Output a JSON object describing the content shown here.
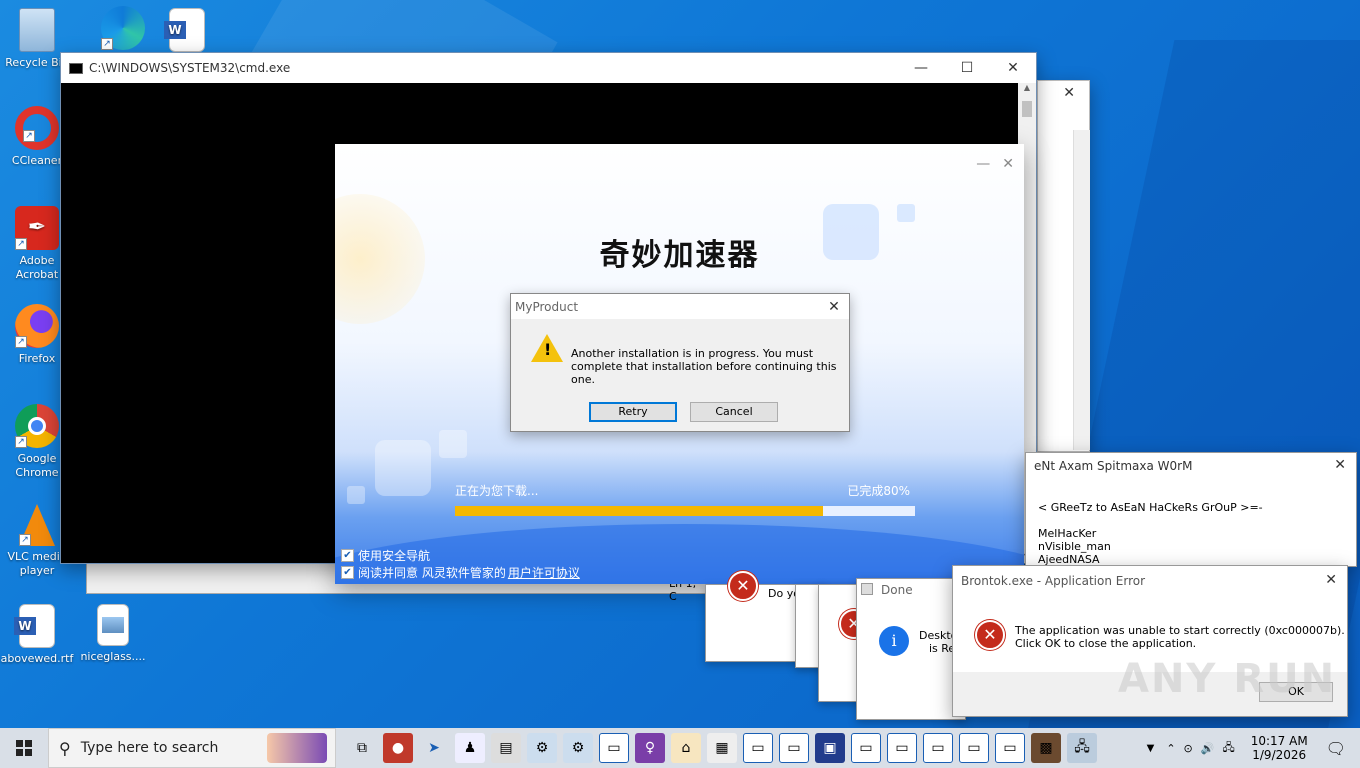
{
  "colors": {
    "accent": "#0078d7",
    "progress": "#f5b800",
    "error": "#c42b1c",
    "info": "#1a73e8"
  },
  "desktop": {
    "icons": [
      {
        "label": "Recycle Bin",
        "icon": "recycle-bin-icon"
      },
      {
        "label": "CCleaner",
        "icon": "ccleaner-icon"
      },
      {
        "label": "Adobe Acrobat",
        "icon": "adobe-acrobat-icon"
      },
      {
        "label": "Firefox",
        "icon": "firefox-icon"
      },
      {
        "label": "Google Chrome",
        "icon": "chrome-icon"
      },
      {
        "label": "VLC media player",
        "icon": "vlc-icon"
      },
      {
        "label": "abovewed.rtf",
        "icon": "word-doc-icon"
      },
      {
        "label": "niceglass....",
        "icon": "image-file-icon"
      }
    ]
  },
  "cmd": {
    "title": "C:\\WINDOWS\\SYSTEM32\\cmd.exe"
  },
  "installer": {
    "title": "奇妙加速器",
    "status": "正在为您下载...",
    "percent_label": "已完成80%",
    "progress": 0.8,
    "check1": "使用安全导航",
    "check2": "阅读并同意 风灵软件管家的",
    "license_link": "用户许可协议"
  },
  "myproduct": {
    "title": "MyProduct",
    "message": "Another installation is in progress. You must complete that installation before continuing this one.",
    "retry": "Retry",
    "cancel": "Cancel"
  },
  "worm": {
    "title": "eNt Axam Spitmaxa W0rM",
    "line1": "< GReeTz to AsEaN HaCkeRs GrOuP >=-",
    "line2": "MelHacKer",
    "line3": "nVisible_man",
    "line4": "AjeedNASA"
  },
  "background_dialogs": {
    "done": "Done",
    "do_partial": "Do yo",
    "desk_partial": "Deskto",
    "is_partial": "is Re",
    "ln_partial": "Ln 1, C"
  },
  "brontok": {
    "title": "Brontok.exe - Application Error",
    "message_line1": "The application was unable to start correctly (0xc000007b).",
    "message_line2": "Click OK to close the application.",
    "ok": "OK"
  },
  "watermark": "ANY RUN",
  "taskbar": {
    "search_placeholder": "Type here to search",
    "time": "10:17 AM",
    "date": "1/9/2026"
  }
}
